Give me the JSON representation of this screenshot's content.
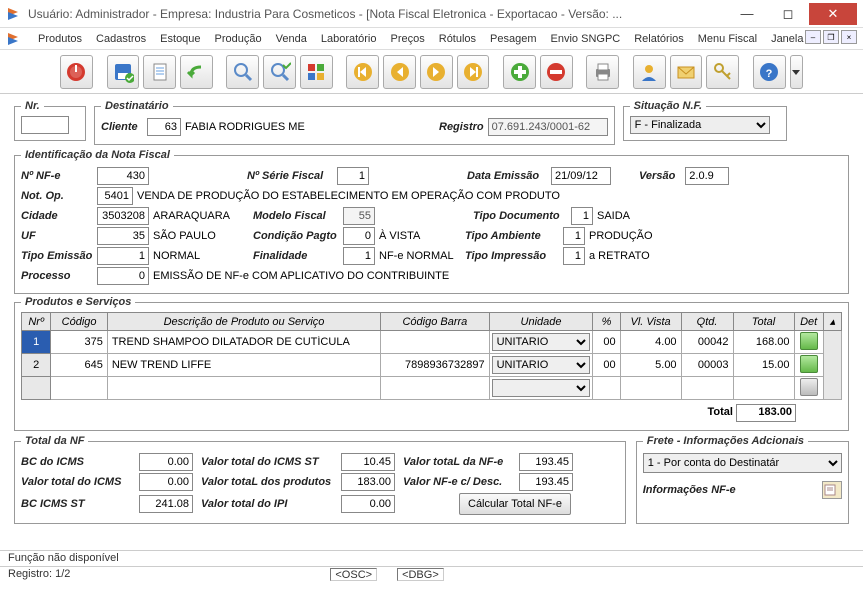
{
  "window": {
    "title": "Usuário: Administrador - Empresa: Industria Para Cosmeticos - [Nota Fiscal Eletronica - Exportacao - Versão: ..."
  },
  "menu": [
    "Produtos",
    "Cadastros",
    "Estoque",
    "Produção",
    "Venda",
    "Laboratório",
    "Preços",
    "Rótulos",
    "Pesagem",
    "Envio SNGPC",
    "Relatórios",
    "Menu Fiscal",
    "Janela"
  ],
  "nr": {
    "label": "Nr.",
    "value": ""
  },
  "destinatario": {
    "legend": "Destinatário",
    "cliente_label": "Cliente",
    "cliente_cod": "63",
    "cliente_nome": "FABIA RODRIGUES ME",
    "registro_label": "Registro",
    "registro": "07.691.243/0001-62"
  },
  "situacao": {
    "legend": "Situação N.F.",
    "value": "F - Finalizada"
  },
  "ident": {
    "legend": "Identificação  da Nota Fiscal",
    "nfe_label": "Nº NF-e",
    "nfe": "430",
    "serie_label": "Nº Série Fiscal",
    "serie": "1",
    "data_label": "Data Emissão",
    "data": "21/09/12",
    "versao_label": "Versão",
    "versao": "2.0.9",
    "notop_label": "Not. Op.",
    "notop_cod": "5401",
    "notop_desc": "VENDA DE PRODUÇÃO DO ESTABELECIMENTO EM OPERAÇÃO COM PRODUTO",
    "cidade_label": "Cidade",
    "cidade_cod": "3503208",
    "cidade_nome": "ARARAQUARA",
    "modelo_label": "Modelo Fiscal",
    "modelo": "55",
    "tipodoc_label": "Tipo Documento",
    "tipodoc_cod": "1",
    "tipodoc_desc": "SAIDA",
    "uf_label": "UF",
    "uf_cod": "35",
    "uf_nome": "SÃO PAULO",
    "condpg_label": "Condição Pagto",
    "condpg_cod": "0",
    "condpg_desc": "À VISTA",
    "tipoamb_label": "Tipo Ambiente",
    "tipoamb_cod": "1",
    "tipoamb_desc": "PRODUÇÃO",
    "tipoem_label": "Tipo Emissão",
    "tipoem_cod": "1",
    "tipoem_desc": "NORMAL",
    "final_label": "Finalidade",
    "final_cod": "1",
    "final_desc": "NF-e NORMAL",
    "tipoimp_label": "Tipo Impressão",
    "tipoimp_cod": "1",
    "tipoimp_desc": "a RETRATO",
    "proc_label": "Processo",
    "proc_cod": "0",
    "proc_desc": "EMISSÃO DE NF-e COM APLICATIVO DO CONTRIBUINTE"
  },
  "produtos": {
    "legend": "Produtos e Serviços",
    "headers": {
      "nr": "Nrº",
      "codigo": "Código",
      "desc": "Descrição de Produto ou Serviço",
      "barra": "Código Barra",
      "unidade": "Unidade",
      "pct": "%",
      "vista": "Vl. Vista",
      "qtd": "Qtd.",
      "total": "Total",
      "det": "Det"
    },
    "rows": [
      {
        "nr": "1",
        "codigo": "375",
        "desc": "TREND SHAMPOO DILATADOR DE CUTÍCULA",
        "barra": "",
        "unidade": "UNITARIO",
        "pct": "00",
        "vista": "4.00",
        "qtd": "00042",
        "total": "168.00"
      },
      {
        "nr": "2",
        "codigo": "645",
        "desc": "NEW TREND LIFFE",
        "barra": "7898936732897",
        "unidade": "UNITARIO",
        "pct": "00",
        "vista": "5.00",
        "qtd": "00003",
        "total": "15.00"
      }
    ],
    "total_label": "Total",
    "total": "183.00"
  },
  "totalnf": {
    "legend": "Total da NF",
    "bcicms_label": "BC do ICMS",
    "bcicms": "0.00",
    "vticmsst_label": "Valor total do ICMS ST",
    "vticmsst": "10.45",
    "vtnfe_label": "Valor totaL da NF-e",
    "vtnfe": "193.45",
    "vticms_label": "Valor total do ICMS",
    "vticms": "0.00",
    "vtprod_label": "Valor totaL dos produtos",
    "vtprod": "183.00",
    "vtdesc_label": "Valor NF-e c/ Desc.",
    "vtdesc": "193.45",
    "bcicmsst_label": "BC ICMS ST",
    "bcicmsst": "241.08",
    "vtipi_label": "Valor total do IPI",
    "vtipi": "0.00",
    "calc_btn": "Cálcular Total NF-e"
  },
  "frete": {
    "legend": "Frete - Informações Adcionais",
    "opt": "1 - Por conta do Destinatár",
    "info_label": "Informações  NF-e"
  },
  "status": {
    "line1": "Função não disponível",
    "registro": "Registro: 1/2",
    "osc": "<OSC>",
    "dbg": "<DBG>"
  }
}
